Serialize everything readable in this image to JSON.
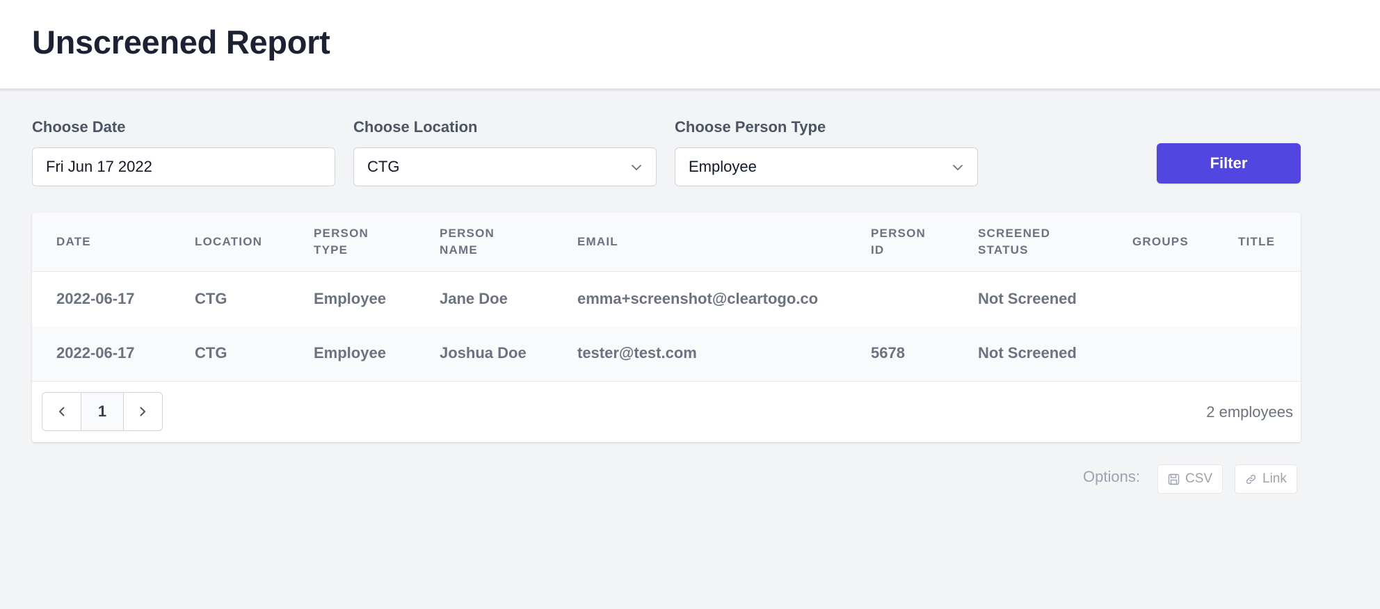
{
  "page": {
    "title": "Unscreened Report"
  },
  "filters": {
    "date_label": "Choose Date",
    "date_value": "Fri Jun 17 2022",
    "location_label": "Choose Location",
    "location_value": "CTG",
    "person_type_label": "Choose Person Type",
    "person_type_value": "Employee",
    "filter_button": "Filter"
  },
  "table": {
    "headers": {
      "date": "DATE",
      "location": "LOCATION",
      "person_type_1": "PERSON",
      "person_type_2": "TYPE",
      "person_name_1": "PERSON",
      "person_name_2": "NAME",
      "email": "EMAIL",
      "person_id_1": "PERSON",
      "person_id_2": "ID",
      "screened_status_1": "SCREENED",
      "screened_status_2": "STATUS",
      "groups": "GROUPS",
      "title": "TITLE"
    },
    "rows": [
      {
        "date": "2022-06-17",
        "location": "CTG",
        "person_type": "Employee",
        "person_name": "Jane Doe",
        "email": "emma+screenshot@cleartogo.co",
        "person_id": "",
        "screened_status": "Not Screened",
        "groups": "",
        "title": ""
      },
      {
        "date": "2022-06-17",
        "location": "CTG",
        "person_type": "Employee",
        "person_name": "Joshua Doe",
        "email": "tester@test.com",
        "person_id": "5678",
        "screened_status": "Not Screened",
        "groups": "",
        "title": ""
      }
    ]
  },
  "pagination": {
    "current_page": "1",
    "count_text": "2 employees"
  },
  "options": {
    "label": "Options:",
    "csv": "CSV",
    "link": "Link"
  },
  "icons": {
    "select": "chevron-down-icon",
    "prev": "chevron-left-icon",
    "next": "chevron-right-icon",
    "csv": "save-icon",
    "link": "link-icon"
  },
  "colors": {
    "accent": "#5146e0",
    "page_bg": "#f3f4f6",
    "header_text": "#1c2233"
  }
}
